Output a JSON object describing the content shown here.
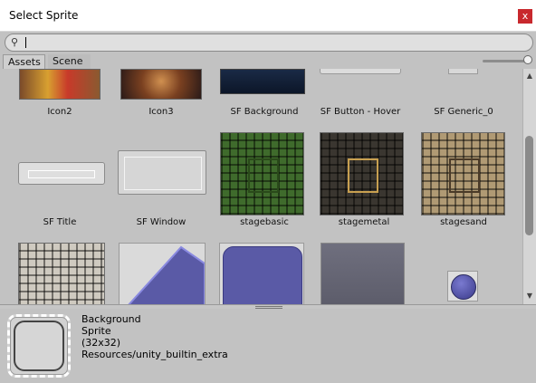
{
  "window": {
    "title": "Select Sprite",
    "close_glyph": "x"
  },
  "search": {
    "value": "",
    "placeholder": ""
  },
  "tabs": [
    {
      "label": "Assets"
    },
    {
      "label": "Scene"
    }
  ],
  "zoom": {
    "value": 1.0
  },
  "grid": {
    "row1": [
      {
        "label": "Icon2"
      },
      {
        "label": "Icon3"
      },
      {
        "label": "SF Background"
      },
      {
        "label": "SF Button - Hover"
      },
      {
        "label": "SF Generic_0"
      }
    ],
    "row2": [
      {
        "label": "SF Title"
      },
      {
        "label": "SF Window"
      },
      {
        "label": "stagebasic"
      },
      {
        "label": "stagemetal"
      },
      {
        "label": "stagesand"
      }
    ]
  },
  "preview": {
    "name": "Background",
    "type": "Sprite",
    "size": "(32x32)",
    "path": "Resources/unity_builtin_extra"
  },
  "colors": {
    "close": "#c8282d",
    "stagebasic": "#3f6b2c",
    "stagemetal": "#3a3630",
    "stagesand": "#b09a74",
    "blue_tile": "#5a5aa6"
  }
}
